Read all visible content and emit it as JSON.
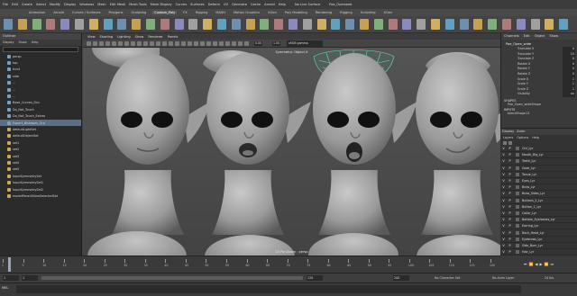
{
  "menubar": {
    "items": [
      "File",
      "Edit",
      "Create",
      "Select",
      "Modify",
      "Display",
      "Windows",
      "Mesh",
      "Edit Mesh",
      "Mesh Tools",
      "Mesh Display",
      "Curves",
      "Surfaces",
      "Deform",
      "UV",
      "Generate",
      "Cache",
      "Arnold",
      "Help"
    ],
    "no_live_surface": "No Live Surface",
    "workspace": "Poe_Openweb"
  },
  "shelf_tabs": {
    "items": [
      "Animation",
      "Arnold",
      "Curves / Surfaces",
      "Polygons",
      "Sculpting",
      "Custom_Poly",
      "FX",
      "Rigging",
      "MASH",
      "Motion Graphics",
      "XGen",
      "Poly Modeling",
      "Rendering",
      "Rigging",
      "Sculpting",
      "XGen"
    ],
    "active_index": 5
  },
  "outliner": {
    "title": "Outliner",
    "menus": [
      "Display",
      "Show",
      "Help"
    ],
    "items": [
      {
        "label": "persp",
        "kind": "cam"
      },
      {
        "label": "top",
        "kind": "cam"
      },
      {
        "label": "front",
        "kind": "cam"
      },
      {
        "label": "side",
        "kind": "cam"
      },
      {
        "label": "...",
        "kind": "cam"
      },
      {
        "label": "...",
        "kind": "cam"
      },
      {
        "label": "...",
        "kind": "cam"
      },
      {
        "label": "Base_Curves_Grp",
        "kind": "grp"
      },
      {
        "label": "Do_Not_Touch",
        "kind": "grp"
      },
      {
        "label": "Do_Not_Touch_Extras",
        "kind": "grp"
      },
      {
        "label": "Export_Blshapes_Grp",
        "kind": "grp",
        "selected": true
      },
      {
        "label": "defaultLightSet",
        "kind": "set"
      },
      {
        "label": "defaultObjectSet",
        "kind": "set"
      },
      {
        "label": "set1",
        "kind": "set"
      },
      {
        "label": "set2",
        "kind": "set"
      },
      {
        "label": "set3",
        "kind": "set"
      },
      {
        "label": "set4",
        "kind": "set"
      },
      {
        "label": "set5",
        "kind": "set"
      },
      {
        "label": "InputSymmetrySet",
        "kind": "set"
      },
      {
        "label": "InputSymmetrySet1",
        "kind": "set"
      },
      {
        "label": "InputSymmetrySet2",
        "kind": "set"
      },
      {
        "label": "modelPanel4ViewSelectedSet",
        "kind": "set"
      }
    ]
  },
  "viewport": {
    "menus": [
      "View",
      "Shading",
      "Lighting",
      "Show",
      "Renderer",
      "Panels"
    ],
    "symmetry_label": "Symmetry: Object X",
    "camera_label": "20 PanZoom : persp",
    "colorspace": "sRGB gamma",
    "exposure": "0.00",
    "gamma": "1.00"
  },
  "channel_box": {
    "tabs": [
      "Channels",
      "Edit",
      "Object",
      "Show"
    ],
    "object_name": "Poe_Open_wide",
    "attributes": [
      {
        "name": "Translate X",
        "value": "0"
      },
      {
        "name": "Translate Y",
        "value": "15"
      },
      {
        "name": "Translate Z",
        "value": "0"
      },
      {
        "name": "Rotate X",
        "value": "0"
      },
      {
        "name": "Rotate Y",
        "value": "0"
      },
      {
        "name": "Rotate Z",
        "value": "0"
      },
      {
        "name": "Scale X",
        "value": "1"
      },
      {
        "name": "Scale Y",
        "value": "1"
      },
      {
        "name": "Scale Z",
        "value": "1"
      },
      {
        "name": "Visibility",
        "value": "on"
      }
    ],
    "shapes_title": "SHAPES",
    "shape_name": "Poe_Open_wideShape",
    "inputs_title": "INPUTS",
    "input_name": "blendShape13"
  },
  "layers": {
    "tabs": [
      "Display",
      "Anim"
    ],
    "menus": [
      "Layers",
      "Options",
      "Help"
    ],
    "rows": [
      {
        "label": "Ctrl_Lyr",
        "selected": false
      },
      {
        "label": "Mouth_Rig_Lyr",
        "selected": false
      },
      {
        "label": "Teeth_Lyr",
        "selected": false
      },
      {
        "label": "Gaze_Lyr",
        "selected": false
      },
      {
        "label": "Tonue_Lyr",
        "selected": false
      },
      {
        "label": "Eyes_Lyr",
        "selected": false
      },
      {
        "label": "Brow_Lyr",
        "selected": false
      },
      {
        "label": "Brow_Sides_Lyr",
        "selected": false
      },
      {
        "label": "Buttons_2_Lyr",
        "selected": false
      },
      {
        "label": "Button_1_Lyr",
        "selected": false
      },
      {
        "label": "Collar_Lyr",
        "selected": false
      },
      {
        "label": "Bottom_Eyelashes_Lyr",
        "selected": false
      },
      {
        "label": "Earring_Lyr",
        "selected": false
      },
      {
        "label": "Back_Head_Lyr",
        "selected": false
      },
      {
        "label": "Eyebrows_Lyr",
        "selected": false
      },
      {
        "label": "Side_Burn_Lyr",
        "selected": false
      },
      {
        "label": "Hair_Lyr",
        "selected": false
      },
      {
        "label": "Sphere_Lyr",
        "selected": true
      }
    ]
  },
  "timeline": {
    "ticks": [
      "1",
      "5",
      "10",
      "15",
      "20",
      "25",
      "30",
      "35",
      "40",
      "45",
      "50",
      "55",
      "60",
      "65",
      "70",
      "75",
      "80",
      "85",
      "90",
      "95",
      "100",
      "105",
      "110",
      "115",
      "120"
    ],
    "current_frame": "1"
  },
  "range": {
    "start": "1",
    "start_inner": "1",
    "end_inner": "120",
    "end": "200",
    "char_set": "No Character Set",
    "anim_layer": "No Anim Layer",
    "fps": "24 fps"
  },
  "statusline": {
    "mel_label": "MEL"
  }
}
